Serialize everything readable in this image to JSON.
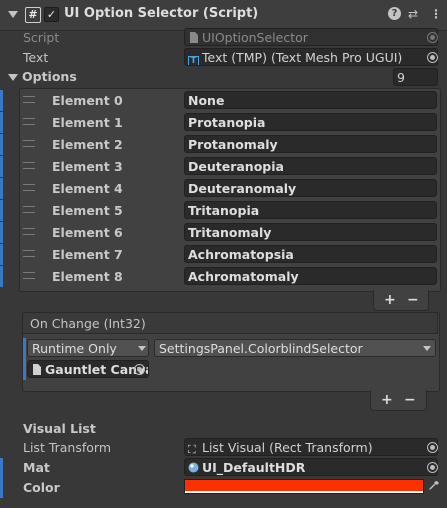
{
  "header": {
    "title": "UI Option Selector (Script)",
    "script_icon": "#",
    "enabled_mark": "✓",
    "icons": [
      "help-icon",
      "presets-icon",
      "more-icon"
    ],
    "help_glyph": "?",
    "presets_glyph": "⇄",
    "more_glyph": "⋮"
  },
  "script": {
    "label": "Script",
    "value": "UIOptionSelector"
  },
  "text": {
    "label": "Text",
    "value": "Text (TMP) (Text Mesh Pro UGUI)",
    "icon_glyph": "T"
  },
  "options": {
    "label": "Options",
    "size": "9",
    "elements": [
      {
        "label": "Element 0",
        "value": "None"
      },
      {
        "label": "Element 1",
        "value": "Protanopia"
      },
      {
        "label": "Element 2",
        "value": "Protanomaly"
      },
      {
        "label": "Element 3",
        "value": "Deuteranopia"
      },
      {
        "label": "Element 4",
        "value": "Deuteranomaly"
      },
      {
        "label": "Element 5",
        "value": "Tritanopia"
      },
      {
        "label": "Element 6",
        "value": "Tritanomaly"
      },
      {
        "label": "Element 7",
        "value": "Achromatopsia"
      },
      {
        "label": "Element 8",
        "value": "Achromatomaly"
      }
    ],
    "add_label": "+",
    "remove_label": "−"
  },
  "on_change": {
    "title": "On Change (Int32)",
    "runtime_value": "Runtime Only",
    "function_value": "SettingsPanel.ColorblindSelector",
    "object_value": "Gauntlet Canva",
    "add_label": "+",
    "remove_label": "−"
  },
  "visual_list": {
    "heading": "Visual List",
    "list_transform": {
      "label": "List Transform",
      "value": "List Visual (Rect Transform)"
    },
    "mat": {
      "label": "Mat",
      "value": "UI_DefaultHDR"
    },
    "color": {
      "label": "Color",
      "value_hex": "#ff3000"
    }
  },
  "colors": {
    "accent_blue": "#3b78c4",
    "panel": "#383838",
    "field": "#2a2a2a"
  }
}
